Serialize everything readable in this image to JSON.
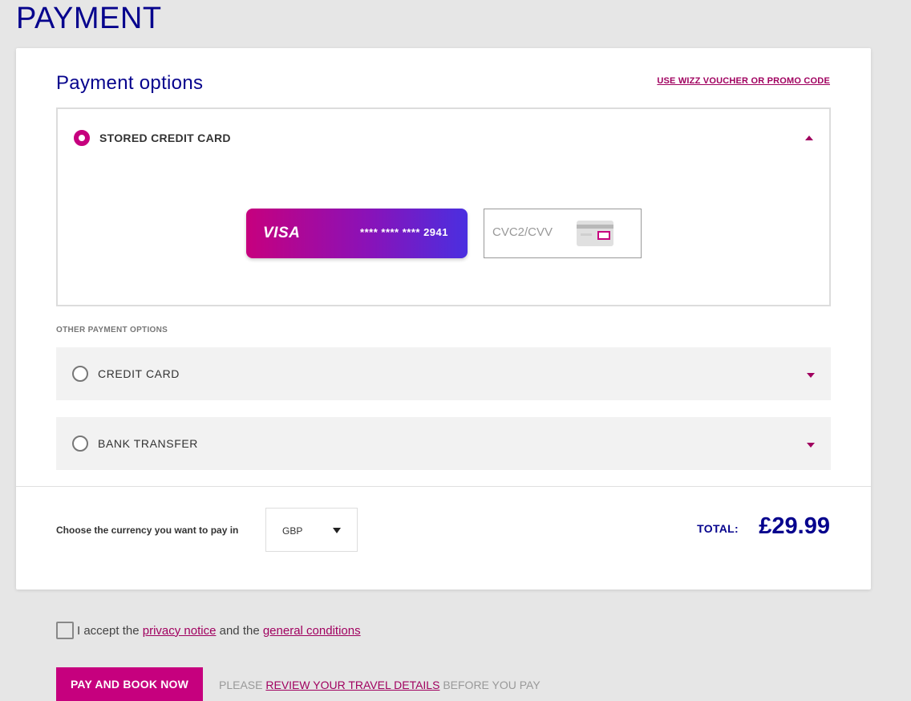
{
  "page": {
    "title": "PAYMENT"
  },
  "payment_options": {
    "title": "Payment options",
    "voucher_link": "USE WIZZ VOUCHER OR PROMO CODE",
    "stored_card": {
      "label": "STORED CREDIT CARD",
      "selected": true,
      "card_brand": "VISA",
      "masked_number": "**** **** **** 2941",
      "cvc_placeholder": "CVC2/CVV"
    },
    "other_label": "OTHER PAYMENT OPTIONS",
    "other_options": [
      {
        "label": "CREDIT CARD"
      },
      {
        "label": "BANK TRANSFER"
      }
    ]
  },
  "currency": {
    "label": "Choose the currency you want to pay in",
    "selected": "GBP"
  },
  "total": {
    "label": "TOTAL:",
    "value": "£29.99"
  },
  "terms": {
    "prefix": "I accept the",
    "privacy_link": "privacy notice",
    "middle": "and the",
    "conditions_link": "general conditions"
  },
  "actions": {
    "pay_button": "PAY AND BOOK NOW",
    "review_prefix": "PLEASE",
    "review_link": "REVIEW YOUR TRAVEL DETAILS",
    "review_suffix": "BEFORE YOU PAY"
  },
  "colors": {
    "brand_navy": "#06038d",
    "brand_magenta": "#c6007e"
  }
}
